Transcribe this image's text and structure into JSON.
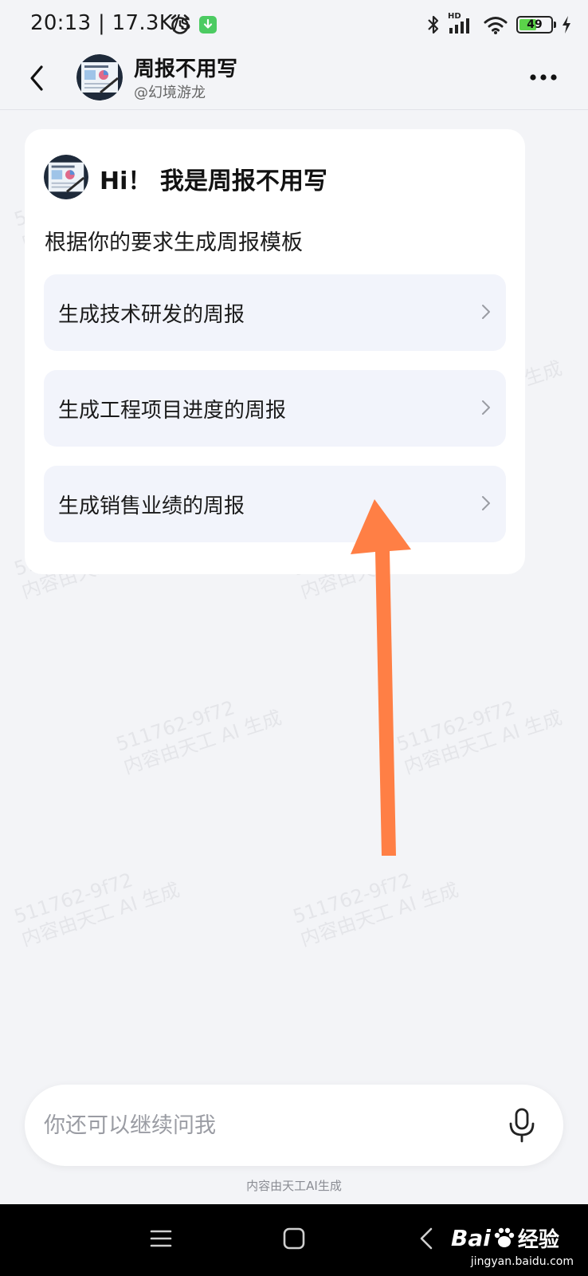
{
  "status_bar": {
    "time": "20:13",
    "separator": "|",
    "net_speed": "17.3K/s",
    "signal_label": "HD",
    "battery": "49"
  },
  "header": {
    "title": "周报不用写",
    "subtitle": "@幻境游龙"
  },
  "card": {
    "greeting": "Hi！ 我是周报不用写",
    "intro": "根据你的要求生成周报模板",
    "options": [
      {
        "label": "生成技术研发的周报"
      },
      {
        "label": "生成工程项目进度的周报"
      },
      {
        "label": "生成销售业绩的周报"
      }
    ]
  },
  "watermark": {
    "line1": "511762-9f72",
    "line2": "内容由天工 AI 生成"
  },
  "input": {
    "placeholder": "你还可以继续问我"
  },
  "footer_note": "内容由天工AI生成",
  "baidu": {
    "brand_left": "Bai",
    "brand_right": "经验",
    "url": "jingyan.baidu.com"
  },
  "colors": {
    "background": "#f3f4f7",
    "card": "#ffffff",
    "option_bg": "#f2f4fb",
    "arrow": "#ff7f45",
    "battery_fill": "#5bd34a"
  }
}
